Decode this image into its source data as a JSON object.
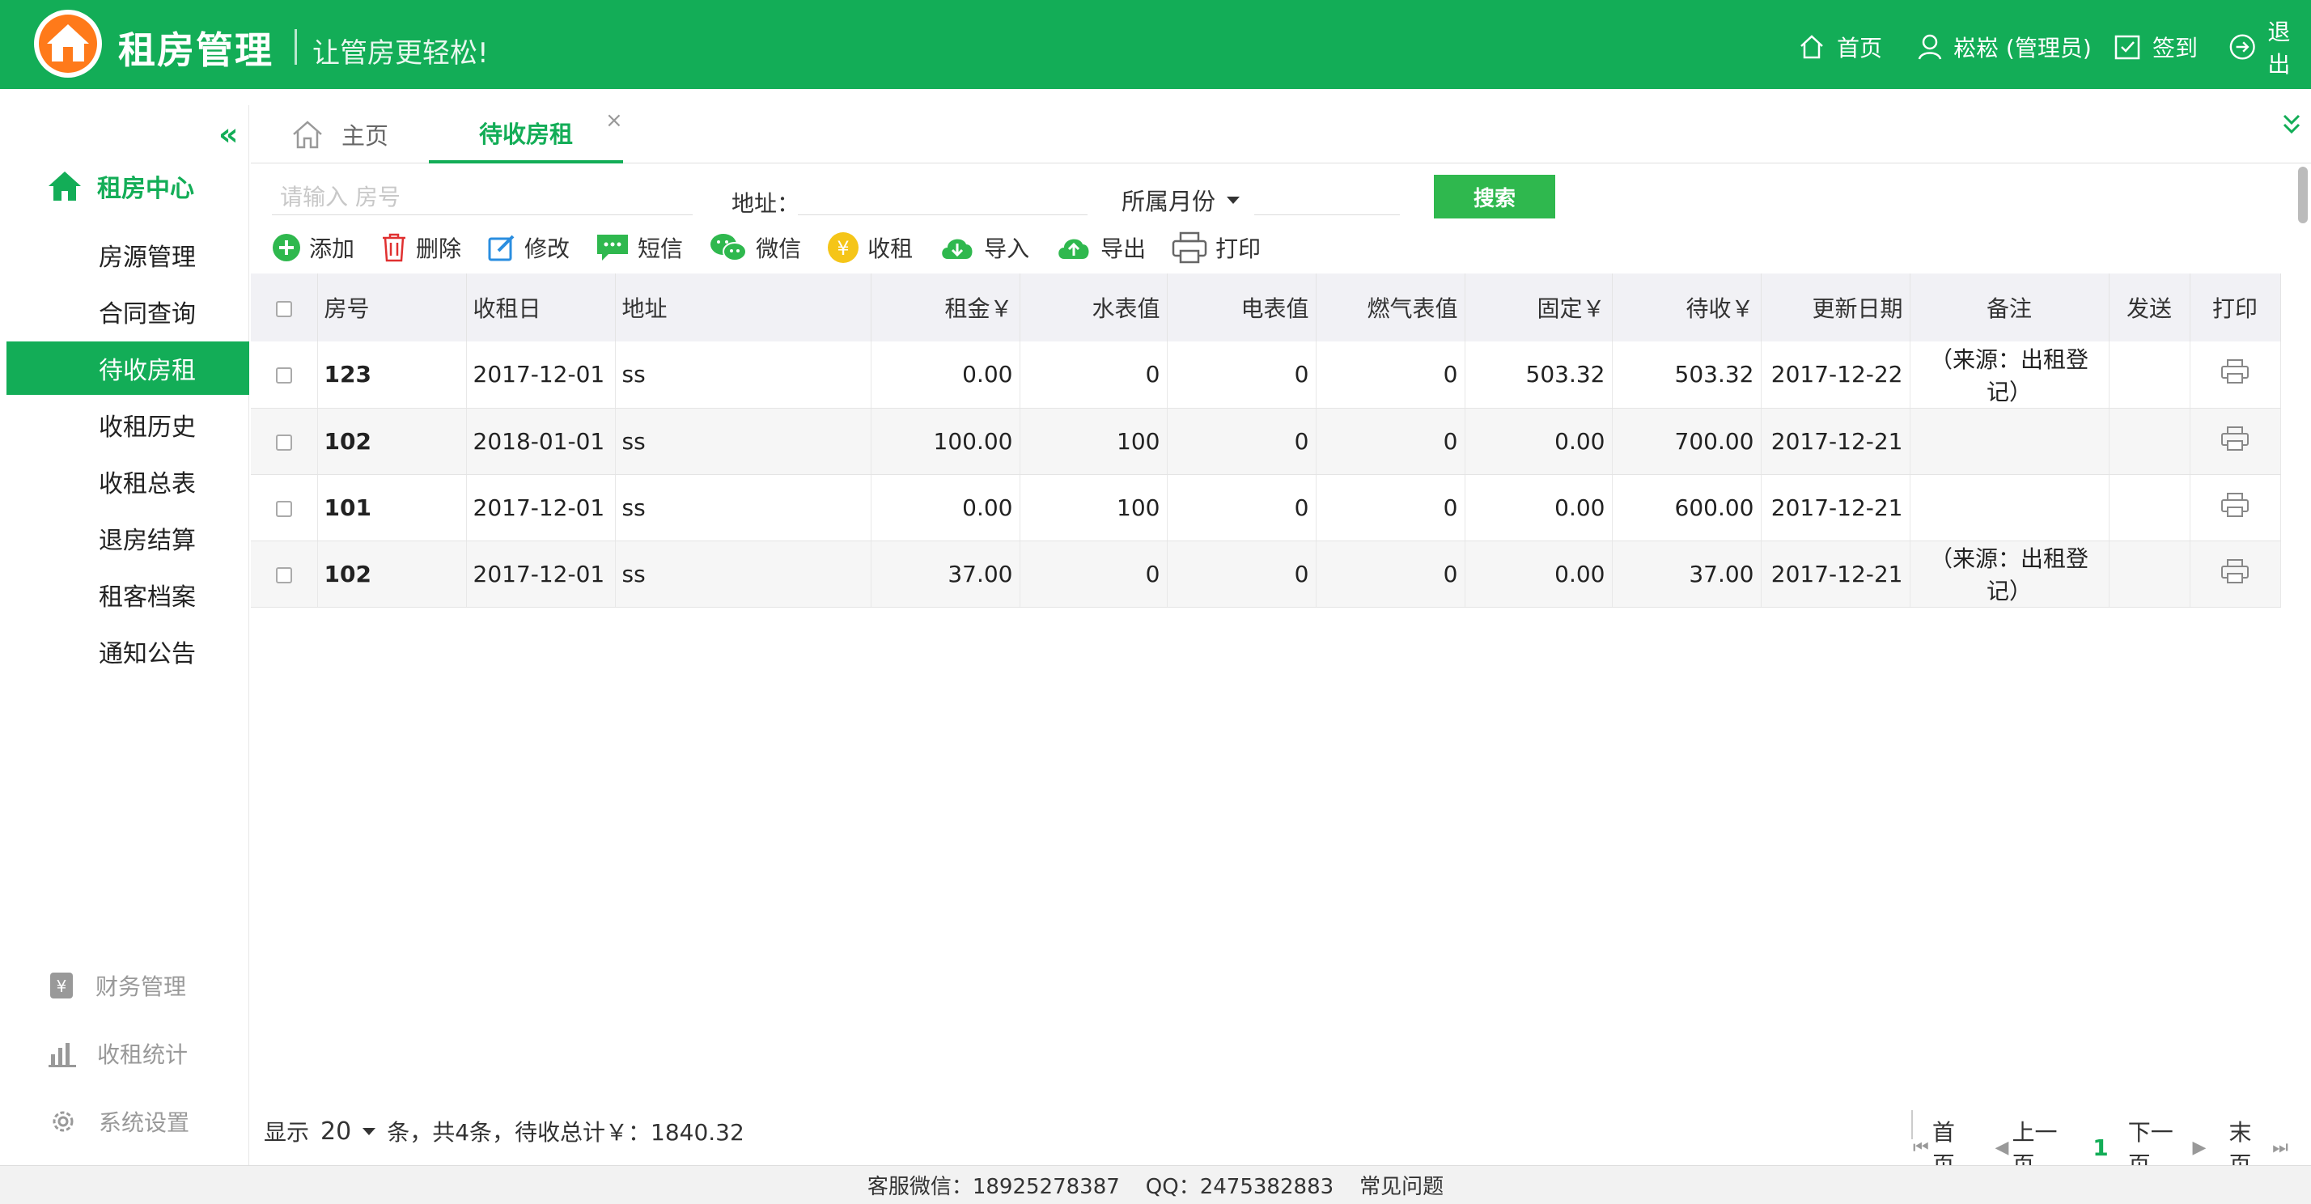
{
  "header": {
    "brand": "租房管理",
    "slogan": "让管房更轻松!",
    "nav": {
      "home": "首页",
      "user": "崧崧 (管理员)",
      "checkin": "签到",
      "logout": "退出"
    }
  },
  "sidebar": {
    "group_title": "租房中心",
    "items": [
      {
        "label": "房源管理"
      },
      {
        "label": "合同查询"
      },
      {
        "label": "待收房租"
      },
      {
        "label": "收租历史"
      },
      {
        "label": "收租总表"
      },
      {
        "label": "退房结算"
      },
      {
        "label": "租客档案"
      },
      {
        "label": "通知公告"
      }
    ],
    "bottom": [
      {
        "label": "财务管理"
      },
      {
        "label": "收租统计"
      },
      {
        "label": "系统设置"
      }
    ]
  },
  "tabs": {
    "home": "主页",
    "active": "待收房租",
    "close": "×"
  },
  "search": {
    "placeholder": "请输入 房号",
    "address_label": "地址：",
    "month_label": "所属月份",
    "button": "搜索"
  },
  "toolbar": {
    "add": "添加",
    "delete": "删除",
    "edit": "修改",
    "sms": "短信",
    "wechat": "微信",
    "collect": "收租",
    "import": "导入",
    "export": "导出",
    "print": "打印"
  },
  "table": {
    "headers": [
      "房号",
      "收租日",
      "地址",
      "租金￥",
      "水表值",
      "电表值",
      "燃气表值",
      "固定￥",
      "待收￥",
      "更新日期",
      "备注",
      "发送",
      "打印"
    ],
    "rows": [
      {
        "room": "123",
        "date": "2017-12-01",
        "addr": "ss",
        "rent": "0.00",
        "water": "0",
        "elec": "0",
        "gas": "0",
        "fixed": "503.32",
        "due": "503.32",
        "updated": "2017-12-22",
        "note": "（来源：出租登记）"
      },
      {
        "room": "102",
        "date": "2018-01-01",
        "addr": "ss",
        "rent": "100.00",
        "water": "100",
        "elec": "0",
        "gas": "0",
        "fixed": "0.00",
        "due": "700.00",
        "updated": "2017-12-21",
        "note": ""
      },
      {
        "room": "101",
        "date": "2017-12-01",
        "addr": "ss",
        "rent": "0.00",
        "water": "100",
        "elec": "0",
        "gas": "0",
        "fixed": "0.00",
        "due": "600.00",
        "updated": "2017-12-21",
        "note": ""
      },
      {
        "room": "102",
        "date": "2017-12-01",
        "addr": "ss",
        "rent": "37.00",
        "water": "0",
        "elec": "0",
        "gas": "0",
        "fixed": "0.00",
        "due": "37.00",
        "updated": "2017-12-21",
        "note": "（来源：出租登记）"
      }
    ]
  },
  "pager": {
    "show": "显示",
    "size": "20",
    "summary": "条，共4条，待收总计￥：1840.32",
    "first": "首页",
    "prev": "上一页",
    "current": "1",
    "next": "下一页",
    "last": "末页"
  },
  "footer": {
    "wechat": "客服微信：18925278387",
    "qq": "QQ：2475382883",
    "faq": "常见问题"
  },
  "colors": {
    "brand": "#13ad57",
    "search_button": "#2fb84e"
  }
}
